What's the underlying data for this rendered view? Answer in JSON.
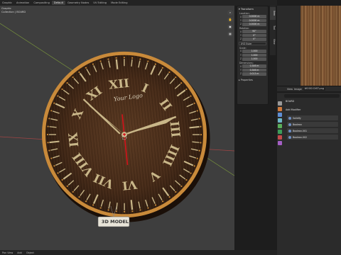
{
  "topbar": {
    "tabs": [
      {
        "label": "Graphic",
        "active": false
      },
      {
        "label": "Animation",
        "active": false
      },
      {
        "label": "Compositing",
        "active": false
      },
      {
        "label": "Default",
        "active": true
      },
      {
        "label": "Geometry Nodes",
        "active": false
      },
      {
        "label": "UV Editing",
        "active": false
      },
      {
        "label": "Mode Editing",
        "active": false
      }
    ],
    "scene_label": "Scene"
  },
  "viewport": {
    "view_label": "Graphic",
    "collection_label": "Collection | BOARD"
  },
  "clock": {
    "logo_text": "Your Logo",
    "badge_text": "3D MODEL",
    "numerals": [
      "XII",
      "I",
      "II",
      "III",
      "IIII",
      "V",
      "VI",
      "VII",
      "VIII",
      "IX",
      "X",
      "XI"
    ],
    "colors": {
      "dial": "#4a2f1c",
      "rim": "#c98a3a",
      "hands": "#c9b789",
      "second_hand": "#d4121a"
    }
  },
  "npanel": {
    "header": "Transform",
    "location_label": "Location:",
    "location": [
      {
        "axis": "X",
        "value": "0.0000 m"
      },
      {
        "axis": "Y",
        "value": "0.0000 m"
      },
      {
        "axis": "Z",
        "value": "0.0000 m"
      }
    ],
    "rotation_label": "Rotation:",
    "rotation": [
      {
        "axis": "X",
        "value": "90°"
      },
      {
        "axis": "Y",
        "value": "0°"
      },
      {
        "axis": "Z",
        "value": "0°"
      }
    ],
    "rotation_mode": "XYZ Euler",
    "scale_label": "Scale:",
    "scale": [
      {
        "axis": "X",
        "value": "1.000"
      },
      {
        "axis": "Y",
        "value": "1.000"
      },
      {
        "axis": "Z",
        "value": "1.000"
      }
    ],
    "dimensions_label": "Dimensions:",
    "dimensions": [
      {
        "axis": "X",
        "value": "0.346 m"
      },
      {
        "axis": "Y",
        "value": "0.346 m"
      },
      {
        "axis": "Z",
        "value": "0.013 m"
      }
    ],
    "properties_label": "Properties"
  },
  "sidebar_tabs": [
    "Item",
    "Tool",
    "View"
  ],
  "image_editor": {
    "view_label": "View",
    "image_label": "Image",
    "image_name": "WOOD DIST.png"
  },
  "properties": {
    "object_name": "BOARD",
    "add_modifier_label": "Add Modifier",
    "modifiers": [
      "Solidify",
      "Boolean",
      "Boolean.001",
      "Boolean.002"
    ]
  },
  "statusbar": {
    "items": [
      "Pan View",
      "Add",
      "Object"
    ]
  }
}
